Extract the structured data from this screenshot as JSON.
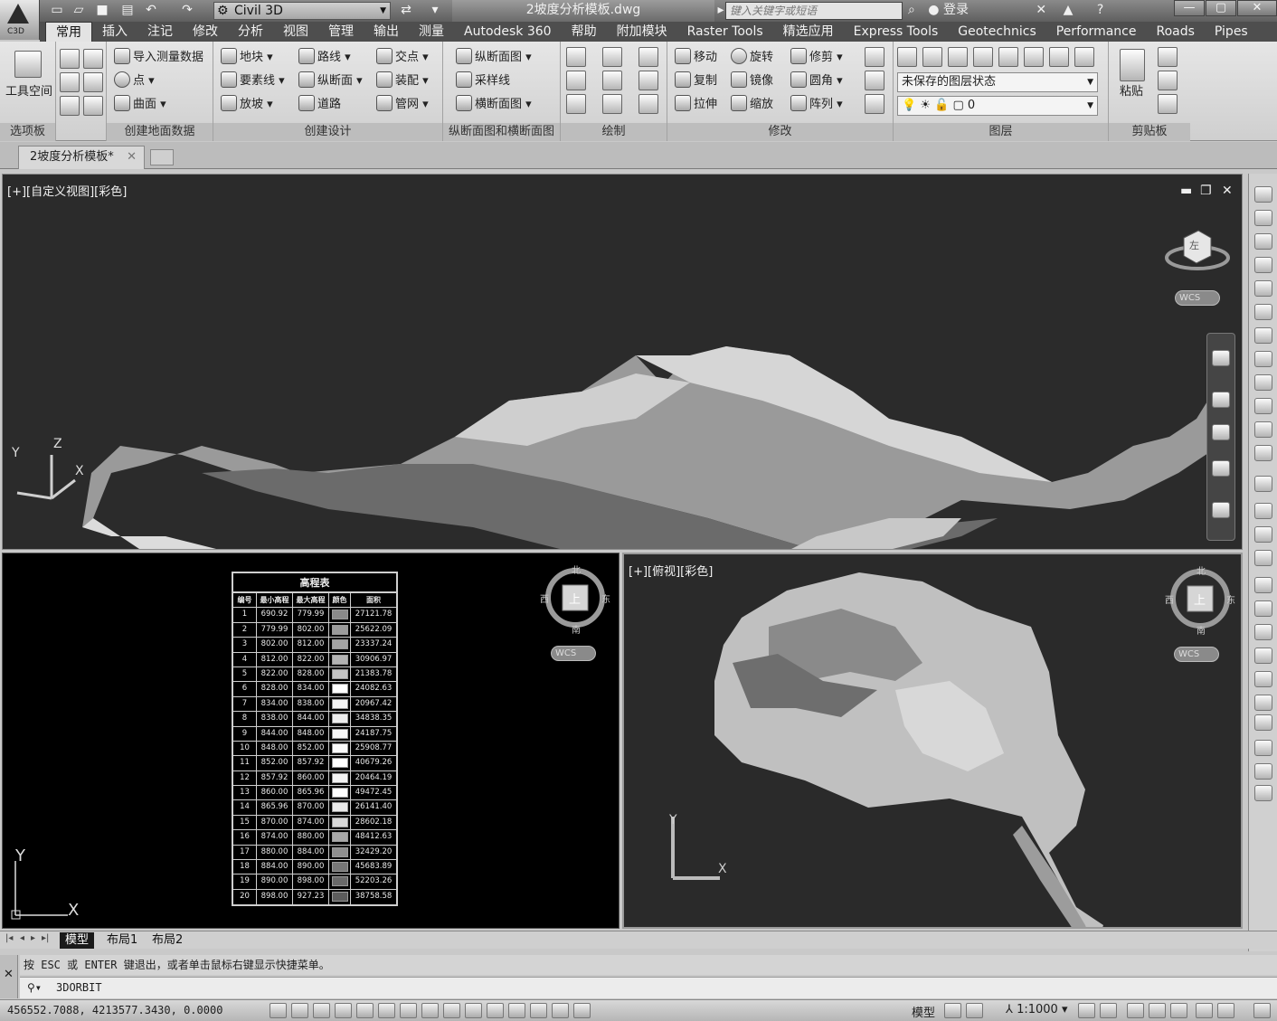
{
  "app": {
    "logo_label": "C3D",
    "workspace": "Civil 3D",
    "document_title": "2坡度分析模板.dwg",
    "search_placeholder": "键入关键字或短语",
    "login_label": "登录",
    "help_label": "?"
  },
  "ribbon_tabs": [
    "常用",
    "插入",
    "注记",
    "修改",
    "分析",
    "视图",
    "管理",
    "输出",
    "测量",
    "Autodesk 360",
    "帮助",
    "附加模块",
    "Raster Tools",
    "精选应用",
    "Express Tools",
    "Geotechnics",
    "Performance",
    "Roads",
    "Pipes"
  ],
  "panels": {
    "toolspace": {
      "title": "选项板",
      "big_button": "工具空间"
    },
    "ground": {
      "title": "创建地面数据",
      "items": [
        "导入测量数据",
        "点",
        "曲面"
      ]
    },
    "design": {
      "title": "创建设计",
      "items": [
        "地块",
        "路线",
        "交点",
        "要素线",
        "纵断面",
        "装配",
        "放坡",
        "道路",
        "管网"
      ]
    },
    "sections": {
      "title": "纵断面图和横断面图",
      "items": [
        "纵断面图",
        "采样线",
        "横断面图"
      ]
    },
    "draw": {
      "title": "绘制"
    },
    "modify": {
      "title": "修改",
      "items": [
        "移动",
        "旋转",
        "修剪",
        "复制",
        "镜像",
        "圆角",
        "拉伸",
        "缩放",
        "阵列"
      ]
    },
    "layers": {
      "title": "图层",
      "layer_state": "未保存的图层状态",
      "current_layer": "0"
    },
    "clipboard": {
      "title": "剪贴板",
      "paste": "粘贴"
    }
  },
  "doc_tabs": {
    "active": "2坡度分析模板*"
  },
  "viewports": {
    "top": {
      "label": "[+][自定义视图][彩色]",
      "axis_x": "X",
      "axis_y": "Y",
      "axis_z": "Z",
      "cube_face": "左",
      "wcs": "WCS"
    },
    "left": {
      "compass": {
        "n": "北",
        "s": "南",
        "e": "东",
        "w": "西",
        "face": "上"
      },
      "wcs": "WCS",
      "axis_x": "X",
      "axis_y": "Y"
    },
    "right": {
      "label": "[+][俯视][彩色]",
      "compass": {
        "n": "北",
        "s": "南",
        "e": "东",
        "w": "西",
        "face": "上"
      },
      "wcs": "WCS",
      "axis_x": "X",
      "axis_y": "Y"
    }
  },
  "elevation_table": {
    "title": "高程表",
    "headers": [
      "编号",
      "最小高程",
      "最大高程",
      "颜色",
      "面积"
    ],
    "rows": [
      {
        "no": "1",
        "min": "690.92",
        "max": "779.99",
        "color": "#8a8a8a",
        "area": "27121.78"
      },
      {
        "no": "2",
        "min": "779.99",
        "max": "802.00",
        "color": "#9b9b9b",
        "area": "25622.09"
      },
      {
        "no": "3",
        "min": "802.00",
        "max": "812.00",
        "color": "#a4a4a4",
        "area": "23337.24"
      },
      {
        "no": "4",
        "min": "812.00",
        "max": "822.00",
        "color": "#b3b3b3",
        "area": "30906.97"
      },
      {
        "no": "5",
        "min": "822.00",
        "max": "828.00",
        "color": "#c4c4c4",
        "area": "21383.78"
      },
      {
        "no": "6",
        "min": "828.00",
        "max": "834.00",
        "color": "#ffffff",
        "area": "24082.63"
      },
      {
        "no": "7",
        "min": "834.00",
        "max": "838.00",
        "color": "#f4f4f4",
        "area": "20967.42"
      },
      {
        "no": "8",
        "min": "838.00",
        "max": "844.00",
        "color": "#ededed",
        "area": "34838.35"
      },
      {
        "no": "9",
        "min": "844.00",
        "max": "848.00",
        "color": "#f7f7f7",
        "area": "24187.75"
      },
      {
        "no": "10",
        "min": "848.00",
        "max": "852.00",
        "color": "#fafafa",
        "area": "25908.77"
      },
      {
        "no": "11",
        "min": "852.00",
        "max": "857.92",
        "color": "#ffffff",
        "area": "40679.26"
      },
      {
        "no": "12",
        "min": "857.92",
        "max": "860.00",
        "color": "#f3f3f3",
        "area": "20464.19"
      },
      {
        "no": "13",
        "min": "860.00",
        "max": "865.96",
        "color": "#fdfdfd",
        "area": "49472.45"
      },
      {
        "no": "14",
        "min": "865.96",
        "max": "870.00",
        "color": "#e9e9e9",
        "area": "26141.40"
      },
      {
        "no": "15",
        "min": "870.00",
        "max": "874.00",
        "color": "#d8d8d8",
        "area": "28602.18"
      },
      {
        "no": "16",
        "min": "874.00",
        "max": "880.00",
        "color": "#a9a9a9",
        "area": "48412.63"
      },
      {
        "no": "17",
        "min": "880.00",
        "max": "884.00",
        "color": "#8f8f8f",
        "area": "32429.20"
      },
      {
        "no": "18",
        "min": "884.00",
        "max": "890.00",
        "color": "#777777",
        "area": "45683.89"
      },
      {
        "no": "19",
        "min": "890.00",
        "max": "898.00",
        "color": "#6a6a6a",
        "area": "52203.26"
      },
      {
        "no": "20",
        "min": "898.00",
        "max": "927.23",
        "color": "#5c5c5c",
        "area": "38758.58"
      }
    ]
  },
  "layout_tabs": [
    "模型",
    "布局1",
    "布局2"
  ],
  "command": {
    "history": "按 ESC 或 ENTER 键退出，或者单击鼠标右键显示快捷菜单。",
    "input": "3DORBIT"
  },
  "status": {
    "coords": "456552.7088, 4213577.3430, 0.0000",
    "model": "模型",
    "scale": "1:1000"
  }
}
